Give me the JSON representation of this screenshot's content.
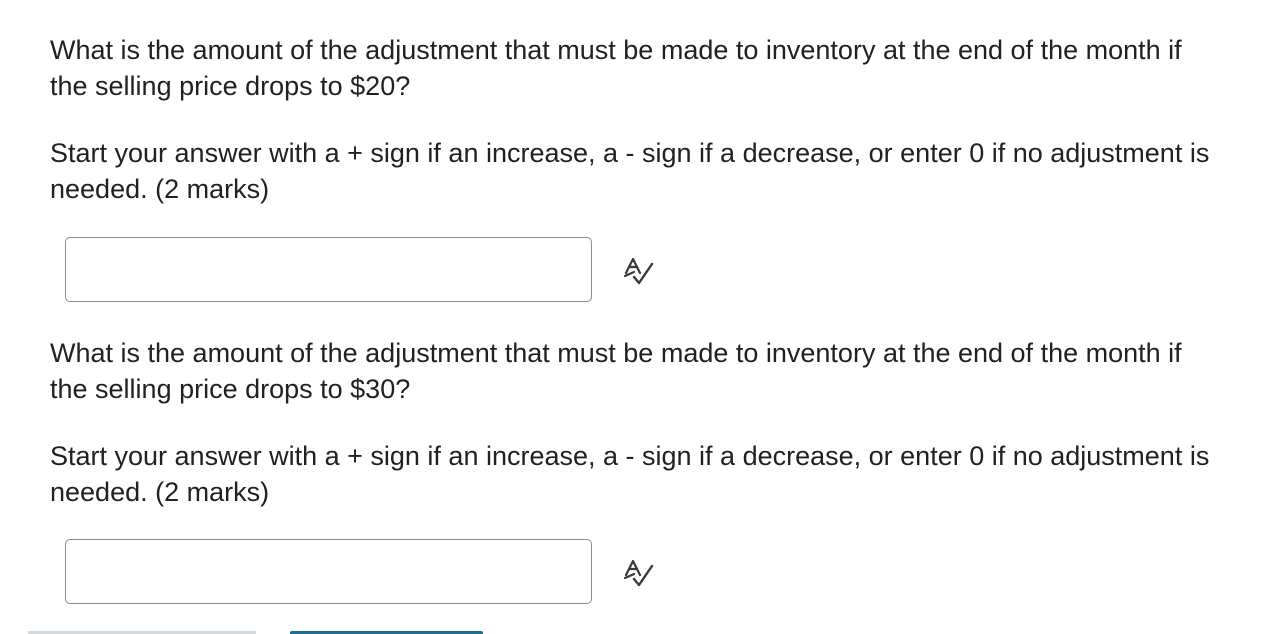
{
  "questions": [
    {
      "text": "What is the amount of the adjustment that must be made to inventory at the end of the month if the selling price drops to $20?",
      "instruction": "Start your answer with a + sign if an increase, a - sign if a decrease, or enter 0 if no adjustment is needed. (2 marks)",
      "answer_value": "",
      "spellcheck_icon": "spell-check-icon"
    },
    {
      "text": "What is the amount of the adjustment that must be made to inventory at the end of the month if the selling price drops to $30?",
      "instruction": "Start your answer with a + sign if an increase, a - sign if a decrease, or enter 0 if no adjustment is needed. (2 marks)",
      "answer_value": "",
      "spellcheck_icon": "spell-check-icon"
    }
  ],
  "colors": {
    "text": "#202122",
    "input_border": "#8c8c8c",
    "accent": "#1b6f8f"
  }
}
